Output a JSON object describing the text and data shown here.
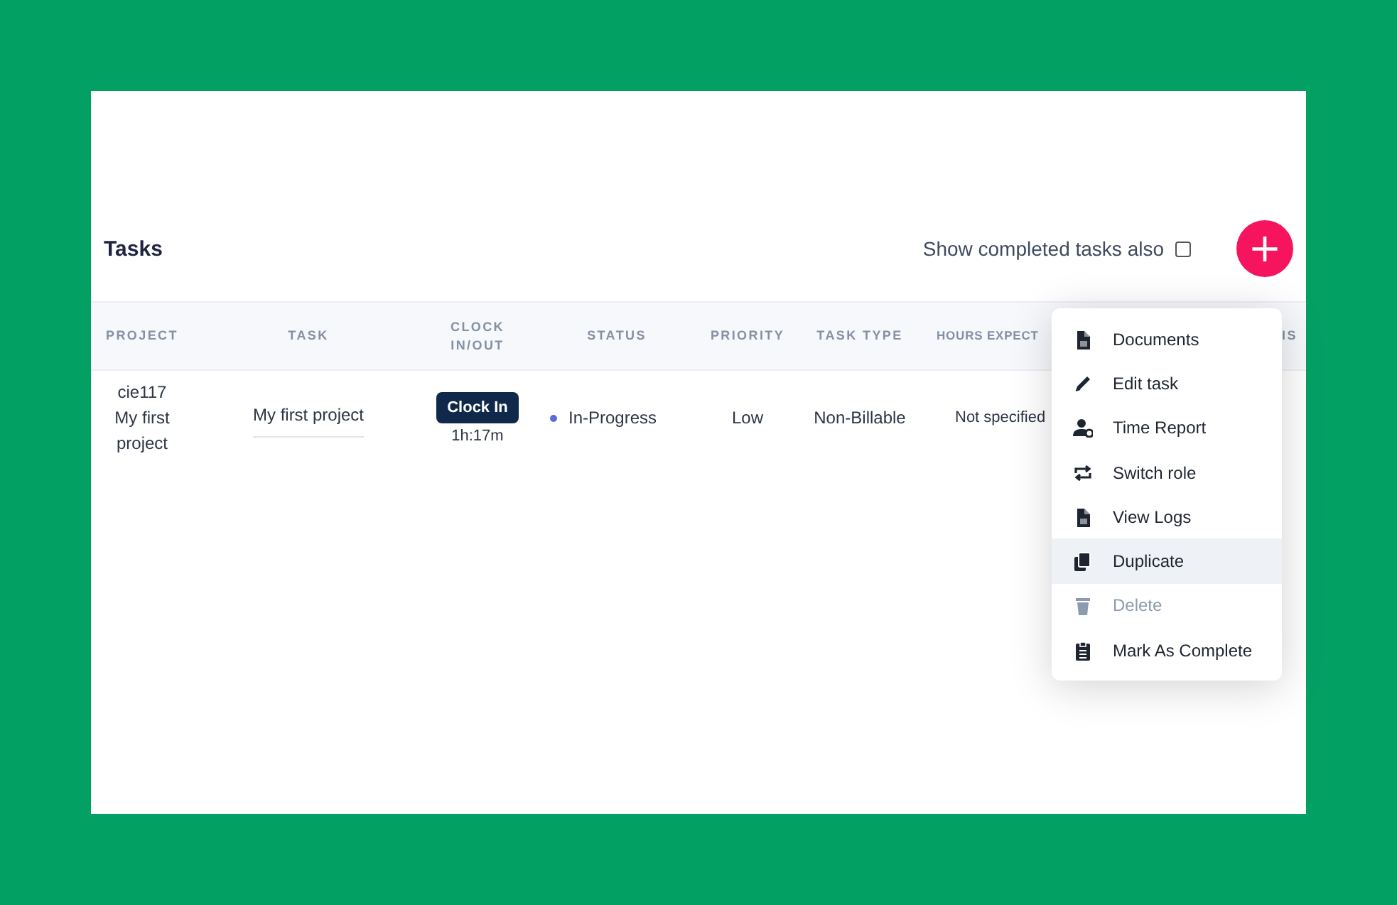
{
  "page": {
    "title": "Tasks",
    "show_completed": {
      "label": "Show completed tasks also",
      "checked": false
    },
    "add_button": {
      "label": "+"
    }
  },
  "table": {
    "columns": [
      "PROJECT",
      "TASK",
      "CLOCK IN/OUT",
      "STATUS",
      "PRIORITY",
      "TASK TYPE",
      "HOURS EXPECT",
      "IS"
    ],
    "rows": [
      {
        "project": "cie117 My first project",
        "task": "My first project",
        "clock_button": "Clock In",
        "clock_time": "1h:17m",
        "status": "In-Progress",
        "priority": "Low",
        "task_type": "Non-Billable",
        "hours_expected": "Not specified"
      }
    ]
  },
  "menu": {
    "items": [
      {
        "kind": "document",
        "label": "Documents",
        "selected": false,
        "disabled": false
      },
      {
        "kind": "pencil",
        "label": "Edit task",
        "selected": false,
        "disabled": false
      },
      {
        "kind": "user",
        "label": "Time Report",
        "selected": false,
        "disabled": false
      },
      {
        "kind": "swap",
        "label": "Switch role",
        "selected": false,
        "disabled": false
      },
      {
        "kind": "document",
        "label": "View Logs",
        "selected": false,
        "disabled": false
      },
      {
        "kind": "copy",
        "label": "Duplicate",
        "selected": true,
        "disabled": false
      },
      {
        "kind": "trash",
        "label": "Delete",
        "selected": false,
        "disabled": true
      },
      {
        "kind": "clipboard",
        "label": "Mark As Complete",
        "selected": false,
        "disabled": false
      }
    ]
  }
}
